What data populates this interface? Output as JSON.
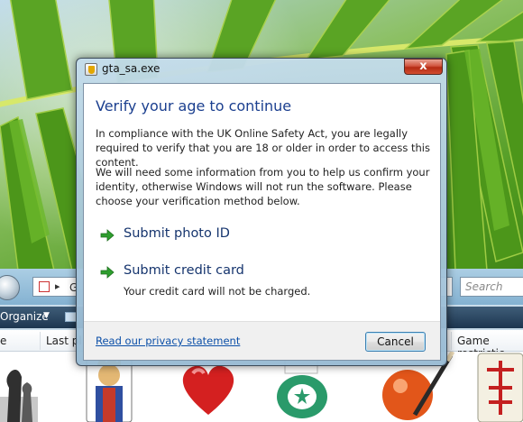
{
  "dialog": {
    "title": "gta_sa.exe",
    "close_glyph": "x",
    "heading": "Verify your age to continue",
    "paragraph1": "In compliance with the UK Online Safety Act, you are legally required to verify that you are 18 or older in order to access this content.",
    "paragraph2": "We will need some information from you to help us confirm your identity, otherwise Windows will not run the software. Please choose your verification method below.",
    "options": [
      {
        "label": "Submit photo ID",
        "sublabel": ""
      },
      {
        "label": "Submit credit card",
        "sublabel": "Your credit card will not be charged."
      }
    ],
    "privacy_link": "Read our privacy statement",
    "cancel_label": "Cancel",
    "accent_color": "#1b3f8f",
    "link_color": "#0b4fa8",
    "arrow_color": "#2e9e2e",
    "icons": [
      "shield-icon",
      "close-icon",
      "green-arrow-icon"
    ]
  },
  "explorer": {
    "address_text": "G",
    "search_placeholder": "Search",
    "organize_label": "Organize",
    "columns": [
      "e",
      "Last pl",
      "Game restrictic"
    ],
    "games": [
      "chess-icon",
      "solitaire-icon",
      "hearts-icon",
      "poker-chip-icon",
      "billiards-icon",
      "mahjong-icon"
    ]
  }
}
